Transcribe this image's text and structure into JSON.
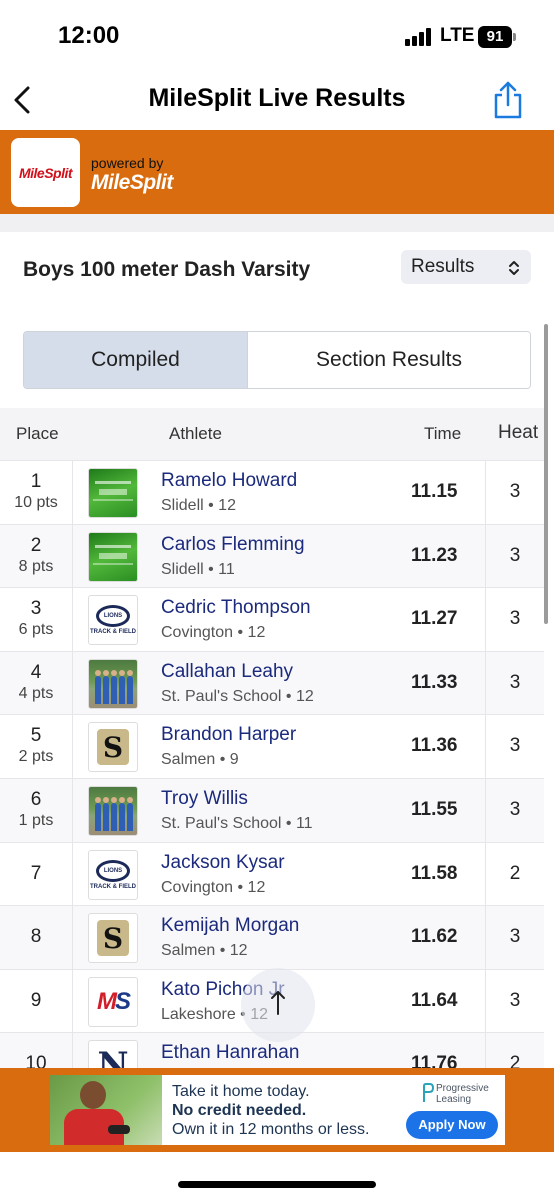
{
  "status_bar": {
    "time": "12:00",
    "network": "LTE",
    "battery": "91"
  },
  "nav": {
    "title": "MileSplit Live Results"
  },
  "brand": {
    "logo_text": "MileSplit",
    "powered_by": "powered by",
    "powered_logo": "MileSplit",
    "accent_color": "#d96c0e"
  },
  "event": {
    "title": "Boys 100 meter Dash Varsity",
    "view_select": "Results"
  },
  "tabs": [
    {
      "label": "Compiled",
      "active": true
    },
    {
      "label": "Section Results",
      "active": false
    }
  ],
  "table": {
    "headers": {
      "place": "Place",
      "athlete": "Athlete",
      "time": "Time",
      "heat": "Heat"
    },
    "rows": [
      {
        "place": "1",
        "pts": "10 pts",
        "name": "Ramelo Howard",
        "sub": "Slidell • 12",
        "time": "11.15",
        "heat": "3",
        "logo": "slidell-logo"
      },
      {
        "place": "2",
        "pts": "8 pts",
        "name": "Carlos Flemming",
        "sub": "Slidell • 11",
        "time": "11.23",
        "heat": "3",
        "logo": "slidell-logo"
      },
      {
        "place": "3",
        "pts": "6 pts",
        "name": "Cedric Thompson",
        "sub": "Covington • 12",
        "time": "11.27",
        "heat": "3",
        "logo": "covington-logo"
      },
      {
        "place": "4",
        "pts": "4 pts",
        "name": "Callahan Leahy",
        "sub": "St. Paul's School • 12",
        "time": "11.33",
        "heat": "3",
        "logo": "st-pauls-photo"
      },
      {
        "place": "5",
        "pts": "2 pts",
        "name": "Brandon Harper",
        "sub": "Salmen • 9",
        "time": "11.36",
        "heat": "3",
        "logo": "salmen-logo"
      },
      {
        "place": "6",
        "pts": "1 pts",
        "name": "Troy Willis",
        "sub": "St. Paul's School • 11",
        "time": "11.55",
        "heat": "3",
        "logo": "st-pauls-photo"
      },
      {
        "place": "7",
        "pts": "",
        "name": "Jackson Kysar",
        "sub": "Covington • 12",
        "time": "11.58",
        "heat": "2",
        "logo": "covington-logo"
      },
      {
        "place": "8",
        "pts": "",
        "name": "Kemijah Morgan",
        "sub": "Salmen • 12",
        "time": "11.62",
        "heat": "3",
        "logo": "salmen-logo"
      },
      {
        "place": "9",
        "pts": "",
        "name": "Kato Pichon Jr",
        "sub": "Lakeshore • 12",
        "time": "11.64",
        "heat": "3",
        "logo": "lakeshore-logo"
      },
      {
        "place": "10",
        "pts": "",
        "name": "Ethan Hanrahan",
        "sub": "",
        "time": "11.76",
        "heat": "2",
        "logo": "northshore-logo"
      }
    ]
  },
  "logo_text": {
    "covington_ring": "LIONS",
    "covington_sub": "TRACK & FIELD",
    "salmen": "S",
    "lakeshore_a": "M",
    "lakeshore_b": "S",
    "northshore": "N"
  },
  "ad": {
    "line1": "Take it home today.",
    "line2": "No credit needed.",
    "line3": "Own it in 12 months or less.",
    "brand": "Progressive Leasing",
    "brand_line1": "Progressive",
    "brand_line2": "Leasing",
    "cta": "Apply Now"
  }
}
